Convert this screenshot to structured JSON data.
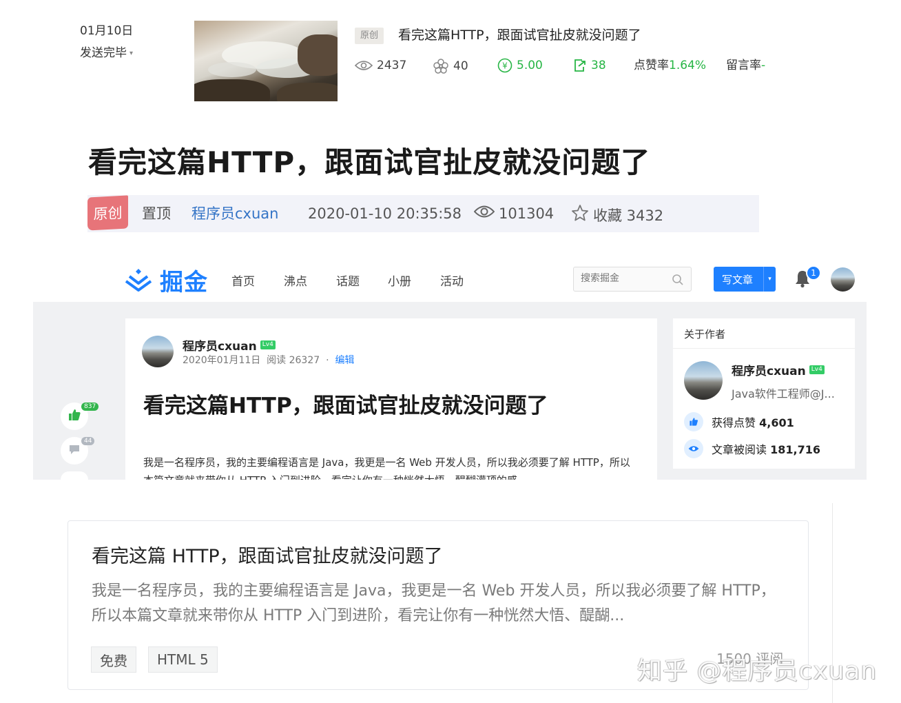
{
  "section1": {
    "date": "01月10日",
    "status": "发送完毕",
    "tag": "原创",
    "title": "看完这篇HTTP，跟面试官扯皮就没问题了",
    "stats": {
      "views": "2437",
      "likes": "40",
      "reward": "5.00",
      "shares": "38",
      "like_rate_label": "点赞率",
      "like_rate_value": "1.64%",
      "comment_rate_label": "留言率",
      "comment_rate_value": "-"
    },
    "colors": {
      "accent_green": "#26b544"
    }
  },
  "section2": {
    "title": "看完这篇HTTP，跟面试官扯皮就没问题了",
    "tag": "原创",
    "pinned": "置顶",
    "author": "程序员cxuan",
    "datetime": "2020-01-10 20:35:58",
    "views": "101304",
    "favorites": "收藏 3432",
    "colors": {
      "tag_bg": "#e77479",
      "author_link": "#3474c6"
    }
  },
  "section3": {
    "logo_text": "掘金",
    "nav": [
      "首页",
      "沸点",
      "话题",
      "小册",
      "活动"
    ],
    "search_placeholder": "搜索掘金",
    "write_button": "写文章",
    "notification_count": "1",
    "article": {
      "author": "程序员cxuan",
      "level": "Lv4",
      "date": "2020年01月11日",
      "reads": "阅读 26327",
      "separator": "·",
      "edit": "编辑",
      "title": "看完这篇HTTP，跟面试官扯皮就没问题了",
      "body": "我是一名程序员，我的主要编程语言是 Java，我更是一名 Web 开发人员，所以我必须要了解 HTTP，所以本篇文章就来带你从 HTTP 入门到进阶，看完让你有一种恍然大悟、醍醐灌顶的感"
    },
    "side_actions": {
      "like_count": "837",
      "comment_count": "44"
    },
    "about_author": {
      "heading": "关于作者",
      "name": "程序员cxuan",
      "level": "Lv4",
      "title": "Java软件工程师@J...",
      "likes_label": "获得点赞",
      "likes_value": "4,601",
      "reads_label": "文章被阅读",
      "reads_value": "181,716"
    },
    "colors": {
      "brand_blue": "#1e80ff",
      "level_green": "#33cc66"
    }
  },
  "section4": {
    "title": "看完这篇 HTTP，跟面试官扯皮就没问题了",
    "description": "我是一名程序员，我的主要编程语言是 Java，我更是一名 Web 开发人员，所以我必须要了解 HTTP，所以本篇文章就来带你从 HTTP 入门到进阶，看完让你有一种恍然大悟、醍醐...",
    "tags": [
      "免费",
      "HTML 5"
    ],
    "reads": "1500 评阅",
    "watermark": "知乎 @程序员cxuan"
  }
}
